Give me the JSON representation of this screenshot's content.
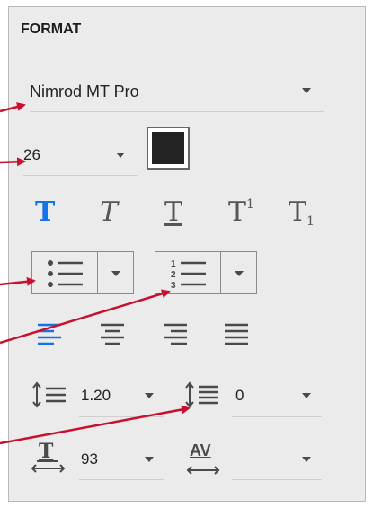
{
  "panel": {
    "title": "FORMAT",
    "font_family": "Nimrod MT Pro",
    "font_size": "26",
    "text_color": "#232323"
  },
  "styles": {
    "bold_glyph": "T",
    "italic_glyph": "T",
    "underline_glyph": "T",
    "superscript_glyph": "T",
    "superscript_mark": "1",
    "subscript_glyph": "T",
    "subscript_mark": "1"
  },
  "lists": {
    "numbered_marks": [
      "1",
      "2",
      "3"
    ]
  },
  "alignment": {
    "active": "left",
    "active_color": "#1473e6"
  },
  "spacing": {
    "line_spacing": "1.20",
    "paragraph_spacing": "0"
  },
  "scaling": {
    "horizontal_scale": "93",
    "tracking_label": "AV",
    "tracking_value": ""
  },
  "annotation_color": "#c8102e"
}
